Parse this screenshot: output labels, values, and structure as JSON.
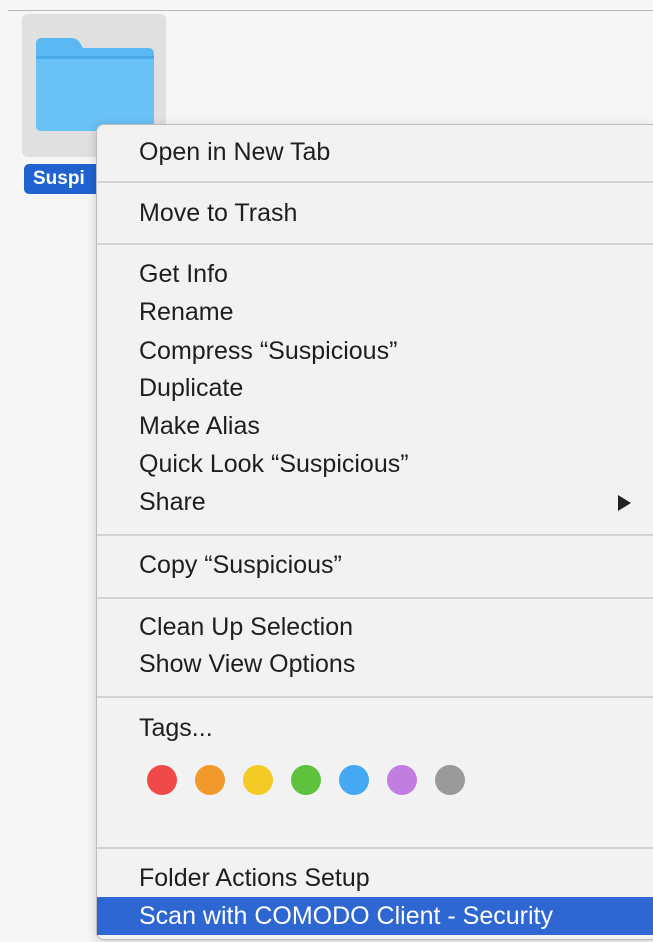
{
  "file": {
    "label": "Suspicious",
    "label_visible": "Suspi"
  },
  "menu": {
    "open_new_tab": "Open in New Tab",
    "move_to_trash": "Move to Trash",
    "get_info": "Get Info",
    "rename": "Rename",
    "compress": "Compress “Suspicious”",
    "duplicate": "Duplicate",
    "make_alias": "Make Alias",
    "quick_look": "Quick Look “Suspicious”",
    "share": "Share",
    "copy": "Copy “Suspicious”",
    "clean_up": "Clean Up Selection",
    "show_view_options": "Show View Options",
    "tags": "Tags...",
    "folder_actions": "Folder Actions Setup",
    "scan_comodo": "Scan with COMODO Client - Security"
  },
  "tag_colors": [
    {
      "name": "red",
      "color": "#f0494a"
    },
    {
      "name": "orange",
      "color": "#f2992c"
    },
    {
      "name": "yellow",
      "color": "#f4cb24"
    },
    {
      "name": "green",
      "color": "#5fc23d"
    },
    {
      "name": "blue",
      "color": "#44a8f2"
    },
    {
      "name": "purple",
      "color": "#c27de0"
    },
    {
      "name": "gray",
      "color": "#9a9a9a"
    }
  ],
  "accent": {
    "highlight": "#2f67d2",
    "folder": "#5cb8f2"
  }
}
